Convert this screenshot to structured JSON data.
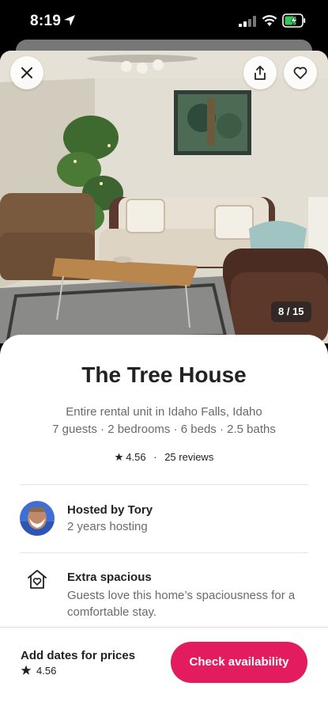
{
  "status_bar": {
    "time": "8:19"
  },
  "photo": {
    "counter": "8 / 15"
  },
  "listing": {
    "title": "The Tree House",
    "location": "Entire rental unit in Idaho Falls, Idaho",
    "details": "7 guests · 2 bedrooms · 6 beds · 2.5 baths",
    "rating": "4.56",
    "separator": "·",
    "reviews": "25 reviews"
  },
  "host": {
    "name": "Hosted by Tory",
    "years": "2 years hosting"
  },
  "feature": {
    "title": "Extra spacious",
    "description": "Guests love this home’s spaciousness for a comfortable stay."
  },
  "footer": {
    "title": "Add dates for prices",
    "rating": "4.56",
    "button_label": "Check availability"
  },
  "colors": {
    "accent": "#e31c5f",
    "text": "#222222",
    "muted": "#6a6a6a"
  },
  "icons": [
    "location-arrow-icon",
    "signal-icon",
    "wifi-icon",
    "battery-charging-icon",
    "close-icon",
    "share-icon",
    "heart-icon",
    "star-icon",
    "home-heart-icon"
  ]
}
